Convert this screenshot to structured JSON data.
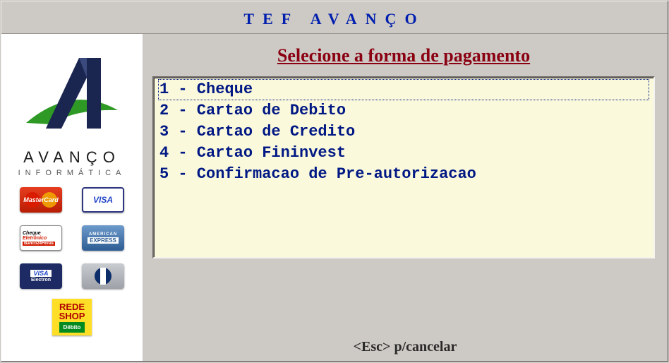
{
  "header": {
    "title": "TEF AVANÇO"
  },
  "sidebar": {
    "brand1": "AVANÇO",
    "brand2": "INFORMÁTICA",
    "cards": {
      "mastercard": "MasterCard",
      "visa": "VISA",
      "cheque_l1": "Cheque",
      "cheque_l2": "Eletrônico",
      "cheque_l3": "Banco24Horas",
      "amex_l1": "AMERICAN",
      "amex_l2": "EXPRESS",
      "visaelectron_l1": "VISA",
      "visaelectron_l2": "Electron",
      "redeshop_l1": "REDE",
      "redeshop_l2": "SHOP",
      "redeshop_l3": "Débito"
    }
  },
  "main": {
    "title": "Selecione a forma de pagamento",
    "options": [
      {
        "num": "1",
        "label": "Cheque"
      },
      {
        "num": "2",
        "label": "Cartao de Debito"
      },
      {
        "num": "3",
        "label": "Cartao de Credito"
      },
      {
        "num": "4",
        "label": "Cartao Fininvest"
      },
      {
        "num": "5",
        "label": "Confirmacao de Pre-autorizacao"
      }
    ],
    "selected_index": 0
  },
  "footer": {
    "hint": "<Esc> p/cancelar"
  }
}
